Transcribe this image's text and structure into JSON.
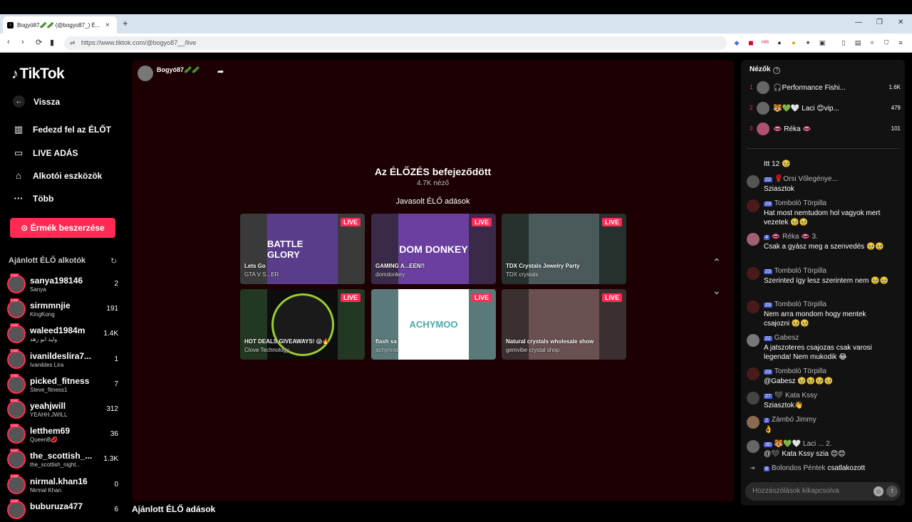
{
  "browser": {
    "tab_title": "Bogyó87🥒🥒 (@bogyo87_) É...",
    "tab_close": "×",
    "new_tab": "+",
    "url": "https://www.tiktok.com/@bogyo87__/live",
    "win_min": "—",
    "win_max": "❐",
    "win_close": "✕"
  },
  "nav": {
    "logo": "TikTok",
    "back": "Vissza",
    "explore_live": "Fedezd fel az ÉLŐT",
    "live_broadcast": "LIVE ADÁS",
    "creator_tools": "Alkotói eszközök",
    "more": "Több",
    "buy_coins": "Érmék beszerzése",
    "recommended_title": "Ajánlott ÉLŐ alkotók"
  },
  "creators": [
    {
      "name": "sanya198146",
      "sub": "Sanya",
      "count": "2"
    },
    {
      "name": "sirmmnjie",
      "sub": "KingKong",
      "count": "191"
    },
    {
      "name": "waleed1984m",
      "sub": "وليد ابو رهد",
      "count": "1.4K"
    },
    {
      "name": "ivanildeslira7...",
      "sub": "Ivanildes Lira",
      "count": "1"
    },
    {
      "name": "picked_fitness",
      "sub": "Steve_fitness1",
      "count": "7"
    },
    {
      "name": "yeahjwill",
      "sub": "YEAHH.JWILL",
      "count": "312"
    },
    {
      "name": "letthem69",
      "sub": "QueenB💋",
      "count": "36"
    },
    {
      "name": "the_scottish_...",
      "sub": "the_scottish_night...",
      "count": "1.3K"
    },
    {
      "name": "nirmal.khan16",
      "sub": "Nirmal Khan",
      "count": "0"
    },
    {
      "name": "buburuza477",
      "sub": "",
      "count": "6"
    }
  ],
  "stream": {
    "host_name": "Bogyó87🥒🥒",
    "ended_title": "Az ÉLŐZÉS befejeződött",
    "viewers": "4.7K néző",
    "suggested_title": "Javasolt ÉLŐ adások",
    "bottom_title": "Ajánlott ÉLŐ adások"
  },
  "cards": [
    {
      "thumb": "BATTLE GLORY",
      "title": "Lets Go",
      "sub": "GTA V S...ER",
      "live": "LIVE"
    },
    {
      "thumb": "DOM DONKEY",
      "title": "GAMING A...EEN!!",
      "sub": "domdonkey",
      "live": "LIVE"
    },
    {
      "thumb": "",
      "title": "TDX Crystals Jewelry Party",
      "sub": "TDX crystals",
      "live": "LIVE"
    },
    {
      "thumb": "",
      "title": "HOT DEALS GIVEAWAYS! 😱🔥",
      "sub": "Clove Technology",
      "live": "LIVE"
    },
    {
      "thumb": "ACHYMOO",
      "title": "flash sa",
      "sub": "achymoo",
      "live": "LIVE"
    },
    {
      "thumb": "",
      "title": "Natural crystals wholesale show",
      "sub": "gemvibe crystal shop",
      "live": "LIVE"
    }
  ],
  "viewers_panel": {
    "title": "Nézők",
    "top": [
      {
        "rank": "1",
        "name": "🎧Performance Fishi...",
        "score": "1.6K"
      },
      {
        "rank": "2",
        "name": "🐯💚🤍 Laci 😊vip...",
        "score": "479"
      },
      {
        "rank": "3",
        "name": "👄 Réka 👄",
        "score": "101"
      }
    ]
  },
  "chat": [
    {
      "lv": "",
      "user": "",
      "text": "Itt 12 🥹"
    },
    {
      "lv": "22",
      "user": "🌹Orsi Vőlegénye...",
      "text": "Sziasztok"
    },
    {
      "lv": "23",
      "user": "Tomboló Törpilla",
      "text": "Hat most nemtudom hol vagyok mert vezetek 🥹🥹"
    },
    {
      "lv": "4",
      "user": "👄 Réka 👄 3.",
      "text": "Csak a gyász meg a szenvedés 🥹🥹"
    },
    {
      "lv": "23",
      "user": "Tomboló Törpilla",
      "text": "Szerinted így lesz szerintem nem 🥹🥹"
    },
    {
      "lv": "23",
      "user": "Tomboló Törpilla",
      "text": "Nem arra mondom hogy mentek csajozni 🥹🥹"
    },
    {
      "lv": "22",
      "user": "Gabesz",
      "text": "A jatszoteres csajozas csak varosi legenda! Nem mukodik 😂"
    },
    {
      "lv": "23",
      "user": "Tomboló Törpilla",
      "text": "@Gabesz 🥹🥹🥹🥹"
    },
    {
      "lv": "27",
      "user": "🖤 Kata Kssy",
      "text": "Sziasztok👋"
    },
    {
      "lv": "2",
      "user": "Zámbó Jimmy",
      "text": "👌"
    },
    {
      "lv": "30",
      "user": "🐯💚🤍 Laci ... 2.",
      "text": "@🖤 Kata Kssy szia 😊😊"
    },
    {
      "lv": "8",
      "user": "Bolondos Péntek",
      "text": "csatlakozott"
    }
  ],
  "chat_input": {
    "placeholder": "Hozzászólások kikapcsolva"
  }
}
